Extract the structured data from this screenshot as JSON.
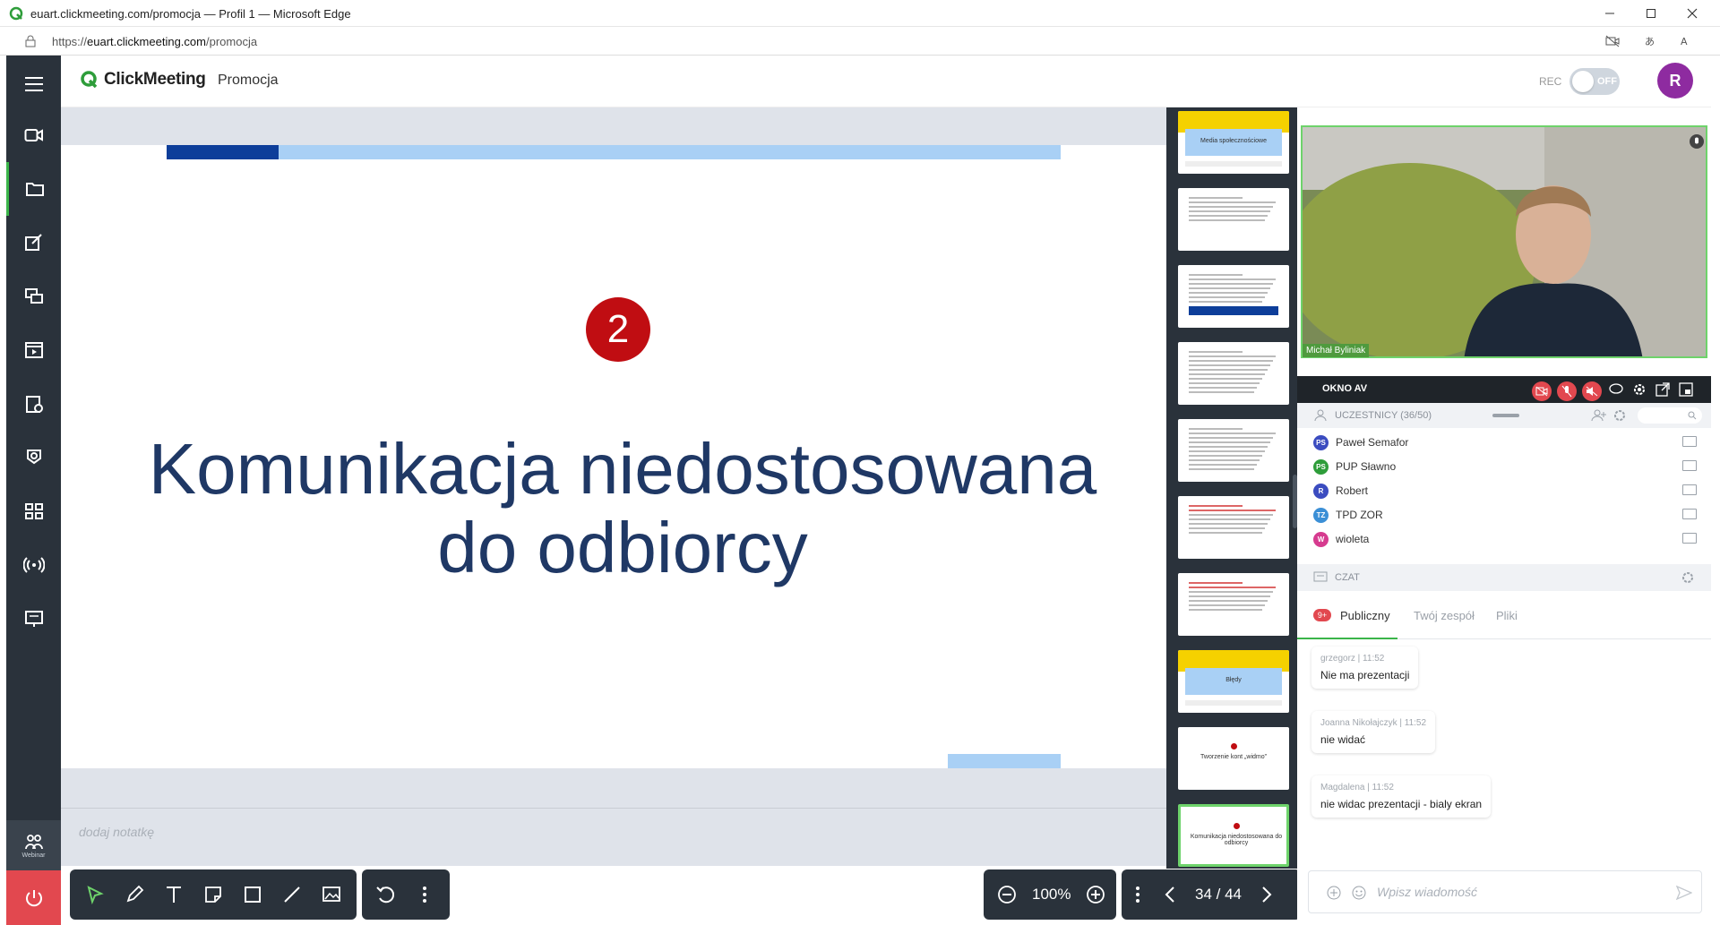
{
  "window": {
    "title": "euart.clickmeeting.com/promocja — Profil 1 — Microsoft Edge",
    "url_prefix": "https://",
    "url_domain": "euart.clickmeeting.com",
    "url_path": "/promocja"
  },
  "header": {
    "logo_text": "ClickMeeting",
    "room_name": "Promocja",
    "rec_label": "REC",
    "rec_toggle_state": "OFF",
    "avatar_initial": "R"
  },
  "sidebar": {
    "items": [
      "video-icon",
      "folder-icon",
      "edit-icon",
      "screens-icon",
      "media-icon",
      "survey-icon",
      "badge-icon",
      "apps-icon",
      "broadcast-icon",
      "presentation-icon"
    ],
    "webinar_label": "Webinar"
  },
  "slide": {
    "badge_number": "2",
    "title_line1": "Komunikacja niedostosowana",
    "title_line2": "do odbiorcy"
  },
  "notes": {
    "placeholder": "dodaj notatkę"
  },
  "toolbar": {
    "zoom": "100%",
    "page": "34 / 44"
  },
  "thumbnails": [
    {
      "title": "Media społecznościowe",
      "type": "banner"
    },
    {
      "title": "",
      "type": "text"
    },
    {
      "title": "",
      "type": "text-box"
    },
    {
      "title": "",
      "type": "dense"
    },
    {
      "title": "",
      "type": "dense"
    },
    {
      "title": "",
      "type": "text-red"
    },
    {
      "title": "",
      "type": "text-red"
    },
    {
      "title": "Błędy",
      "type": "banner"
    },
    {
      "title": "Tworzenie kont „widmo”",
      "type": "dot"
    },
    {
      "title": "Komunikacja niedostosowana do odbiorcy",
      "type": "dot"
    }
  ],
  "video": {
    "speaker_name": "Michał Byliniak"
  },
  "av_panel": {
    "label": "OKNO AV"
  },
  "participants": {
    "header": "UCZESTNICY (36/50)",
    "list": [
      {
        "initials": "PS",
        "name": "Paweł Semafor",
        "color": "#3b4cc0"
      },
      {
        "initials": "PS",
        "name": "PUP Sławno",
        "color": "#2e9d3a"
      },
      {
        "initials": "R",
        "name": "Robert",
        "color": "#3b4cc0"
      },
      {
        "initials": "TZ",
        "name": "TPD ZOR",
        "color": "#3b8fd6"
      },
      {
        "initials": "W",
        "name": "wioleta",
        "color": "#d63b8f"
      }
    ]
  },
  "chat": {
    "header": "CZAT",
    "unread": "9+",
    "tabs": [
      "Publiczny",
      "Twój zespół",
      "Pliki"
    ],
    "messages": [
      {
        "author": "grzegorz",
        "time": "11:52",
        "text": "Nie ma prezentacji"
      },
      {
        "author": "Joanna Nikołajczyk",
        "time": "11:52",
        "text": "nie widać"
      },
      {
        "author": "Magdalena",
        "time": "11:52",
        "text": "nie widac prezentacji - bialy ekran"
      }
    ],
    "input_placeholder": "Wpisz wiadomość"
  },
  "colors": {
    "accent": "#3bb54a",
    "sidebar": "#2a323b",
    "slide_title": "#1f3865",
    "badge": "#c00d12",
    "avatar": "#8e2ba0"
  }
}
